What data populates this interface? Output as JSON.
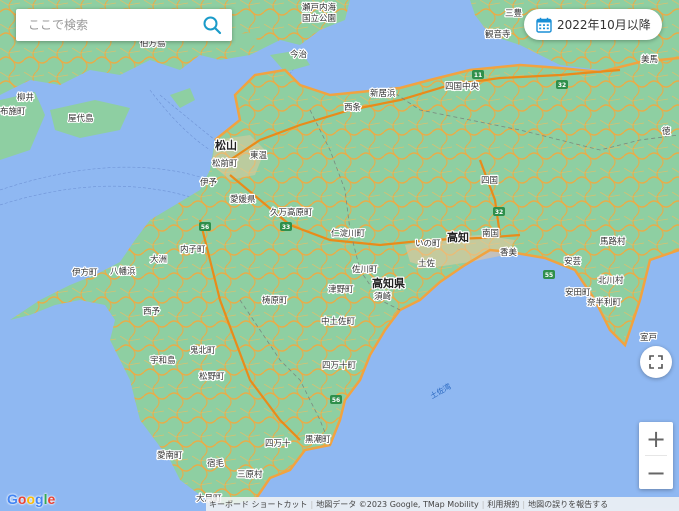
{
  "search": {
    "placeholder": "ここで検索"
  },
  "date_filter": {
    "label": "2022年10月以降"
  },
  "map_labels": {
    "setonaikai_1": "瀬戸内海",
    "setonaikai_2": "国立公園",
    "mitoyo": "三豊",
    "kanonji": "観音寺",
    "mitoyo_city": "三豊市",
    "sakaide_top": "坂出",
    "hashihama": "伯方島",
    "imabari": "今治",
    "nakajima": "中島",
    "yashiro": "屋代島",
    "yanai": "柳井",
    "suo_oshima": "周防大島",
    "fuse": "布施町",
    "mishima": "三島",
    "shikokuchuo": "四国中央",
    "niihama": "新居浜",
    "saijo": "西条",
    "matsuyama": "松山",
    "toon": "東温",
    "matsuyama_city": "松前町",
    "iyo": "伊予",
    "ehime": "愛媛県",
    "kumakogen": "久万高原町",
    "niyodogawa": "仁淀川町",
    "shikoku": "四国",
    "ino": "いの町",
    "kochi": "高知",
    "nankoku": "南国",
    "kami": "香美",
    "umaji": "馬路村",
    "aki": "安芸",
    "kitagawa": "北川村",
    "yasuda": "安田町",
    "nahari": "奈半利町",
    "muroto": "室戸",
    "tosa": "土佐",
    "kochi_pref": "高知県",
    "susaki": "須崎",
    "sakawa": "佐川町",
    "tsuno": "津野町",
    "uchiko": "内子町",
    "ozu": "大洲",
    "yawatahama": "八幡浜",
    "yawatahama_city": "伊方町",
    "seiyo": "西予",
    "yusuhara": "梼原町",
    "nakatosa": "中土佐町",
    "shimanto_cho": "四万十町",
    "kihoku": "鬼北町",
    "uwajima": "宇和島",
    "matsuno": "松野町",
    "shimanto": "四万十",
    "kuroshio": "黒潮町",
    "ainan": "愛南町",
    "sukumo": "宿毛",
    "mihara": "三原村",
    "otsuki": "大月町",
    "tosa_bay": "土佐湾",
    "toku": "徳",
    "mima": "美馬"
  },
  "road_shields": [
    "11",
    "32",
    "33",
    "56",
    "56",
    "32",
    "55"
  ],
  "controls": {
    "zoom_in": "+",
    "zoom_out": "−"
  },
  "footer": {
    "shortcuts": "キーボード ショートカット",
    "attribution": "地図データ ©2023 Google, TMap Mobility",
    "terms": "利用規約",
    "report": "地図の誤りを報告する"
  },
  "logo": {
    "g1": "G",
    "o1": "o",
    "o2": "o",
    "g2": "g",
    "l": "l",
    "e": "e"
  },
  "colors": {
    "sea": "#8fb8f2",
    "land": "#8ecfa2",
    "coverage_road": "#f1a340",
    "plain": "#b8dfbe"
  }
}
